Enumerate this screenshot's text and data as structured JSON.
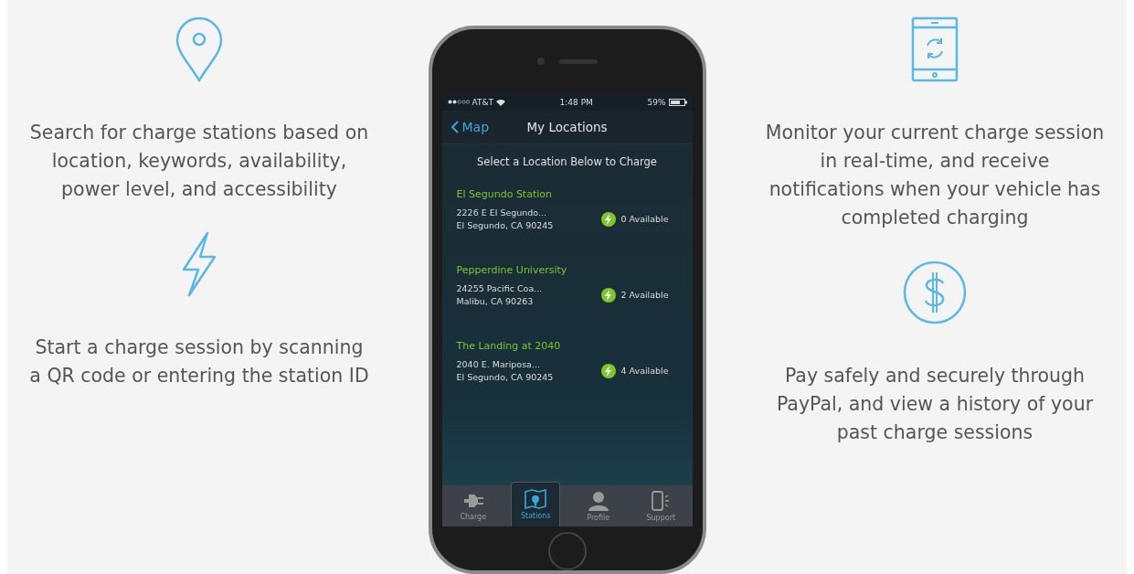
{
  "features_left": [
    {
      "kind": "pin",
      "text": "Search for charge stations based on location, keywords, availability, power level, and accessibility"
    },
    {
      "kind": "bolt",
      "text": "Start a charge session by scanning a QR code or entering the station ID"
    }
  ],
  "phone": {
    "status_bar": {
      "carrier": "AT&T",
      "time": "1:48 PM",
      "battery": "59%"
    },
    "nav": {
      "back": "Map",
      "title": "My Locations"
    },
    "subtitle": "Select a Location Below to Charge",
    "locations": [
      {
        "name": "El Segundo Station",
        "address_1": "2226 E El Segundo...",
        "address_2": "El Segundo, CA 90245",
        "available": "0 Available"
      },
      {
        "name": "Pepperdine University",
        "address_1": "24255 Pacific Coa...",
        "address_2": "Malibu, CA 90263",
        "available": "2 Available"
      },
      {
        "name": "The Landing at 2040",
        "address_1": "2040 E. Mariposa...",
        "address_2": "El Segundo, CA 90245",
        "available": "4 Available"
      }
    ],
    "tabs": [
      {
        "kind": "plug",
        "label": "Charge",
        "selected": false
      },
      {
        "kind": "map",
        "label": "Stations",
        "selected": true
      },
      {
        "kind": "person",
        "label": "Profile",
        "selected": false
      },
      {
        "kind": "phone",
        "label": "Support",
        "selected": false
      }
    ]
  },
  "features_right": [
    {
      "kind": "phone-sync",
      "text": "Monitor your current charge session in real-time, and receive notifications when your vehicle has completed charging"
    },
    {
      "kind": "dollar",
      "text": "Pay safely and securely through PayPal, and view a history of your past charge sessions"
    }
  ]
}
